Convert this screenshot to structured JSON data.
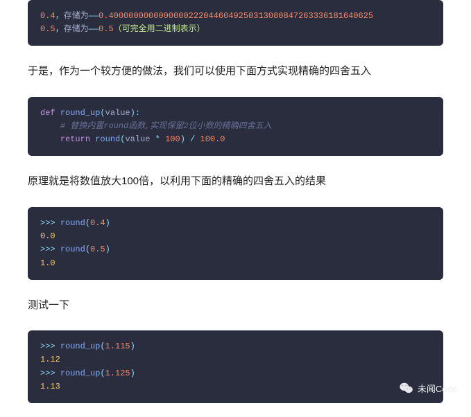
{
  "block1": {
    "l1_num": "0.4",
    "l1_punc": "，",
    "l1_txt": "存储为",
    "l1_dash": "——",
    "l1_val": "0.40000000000000002220446049250313080847263336181640625",
    "l2_num": "0.5",
    "l2_punc": "，",
    "l2_txt": "存储为",
    "l2_dash": "——",
    "l2_val": "0.5",
    "l2_note": "（可完全用二进制表示）"
  },
  "para1": "于是，作为一个较方便的做法，我们可以使用下面方式实现精确的四舍五入",
  "block2": {
    "def": "def",
    "fname": "round_up",
    "lp": "(",
    "arg": "value",
    "rp": ")",
    "colon": ":",
    "comment": "# 替换内置round函数,实现保留2位小数的精确四舍五入",
    "ret": "return",
    "round": "round",
    "lp2": "(",
    "arg2": "value",
    "op": "*",
    "n100": "100",
    "rp2": ")",
    "div": "/",
    "n100f": "100.0"
  },
  "para2": "原理就是将数值放大100倍，以利用下面的精确的四舍五入的结果",
  "block3": {
    "p1": ">>>",
    "r1": "round",
    "lp1": "(",
    "a1": "0.4",
    "rp1": ")",
    "o1": "0.0",
    "p2": ">>>",
    "r2": "round",
    "lp2": "(",
    "a2": "0.5",
    "rp2": ")",
    "o2": "1.0"
  },
  "para3": "测试一下",
  "block4": {
    "p1": ">>>",
    "r1": "round_up",
    "lp1": "(",
    "a1": "1.115",
    "rp1": ")",
    "o1": "1.12",
    "p2": ">>>",
    "r2": "round_up",
    "lp2": "(",
    "a2": "1.125",
    "rp2": ")",
    "o2": "1.13"
  },
  "watermark": "未闻Code"
}
